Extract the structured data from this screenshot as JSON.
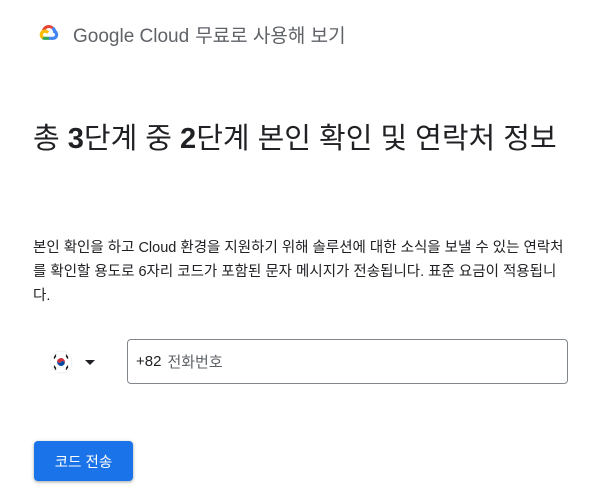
{
  "header": {
    "brand_name": "Google Cloud",
    "brand_suffix": "무료로 사용해 보기",
    "logo_icon": "google-cloud-logo-icon"
  },
  "main": {
    "title_prefix": "총 ",
    "title_step": "3",
    "title_mid": "단계 중 ",
    "title_current": "2",
    "title_rest": "단계 본인 확인 및 연락처 정보",
    "description": "본인 확인을 하고 Cloud 환경을 지원하기 위해 솔루션에 대한 소식을 보낼 수 있는 연락처를 확인할 용도로 6자리 코드가 포함된 문자 메시지가 전송됩니다. 표준 요금이 적용됩니다."
  },
  "phone": {
    "country_flag": "south-korea-flag-icon",
    "prefix": "+82",
    "placeholder": "전화번호"
  },
  "actions": {
    "send_code_label": "코드 전송"
  },
  "colors": {
    "primary": "#1a73e8",
    "text": "#202124",
    "muted": "#5f6368",
    "border": "#80868b"
  }
}
